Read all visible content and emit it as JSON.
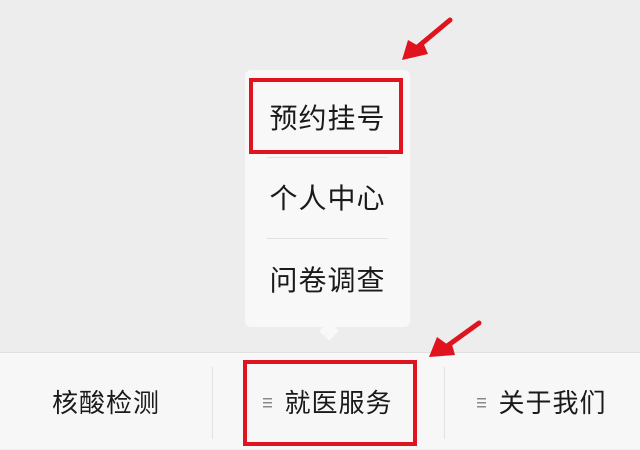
{
  "popup_menu": {
    "items": [
      {
        "label": "预约挂号",
        "highlighted": true
      },
      {
        "label": "个人中心",
        "highlighted": false
      },
      {
        "label": "问卷调查",
        "highlighted": false
      }
    ]
  },
  "menubar": {
    "items": [
      {
        "label": "核酸检测",
        "has_submenu_icon": false
      },
      {
        "label": "就医服务",
        "has_submenu_icon": true,
        "highlighted": true
      },
      {
        "label": "关于我们",
        "has_submenu_icon": true
      }
    ],
    "submenu_icon": "menu-lines-icon"
  },
  "annotation_color": "#e0141e"
}
